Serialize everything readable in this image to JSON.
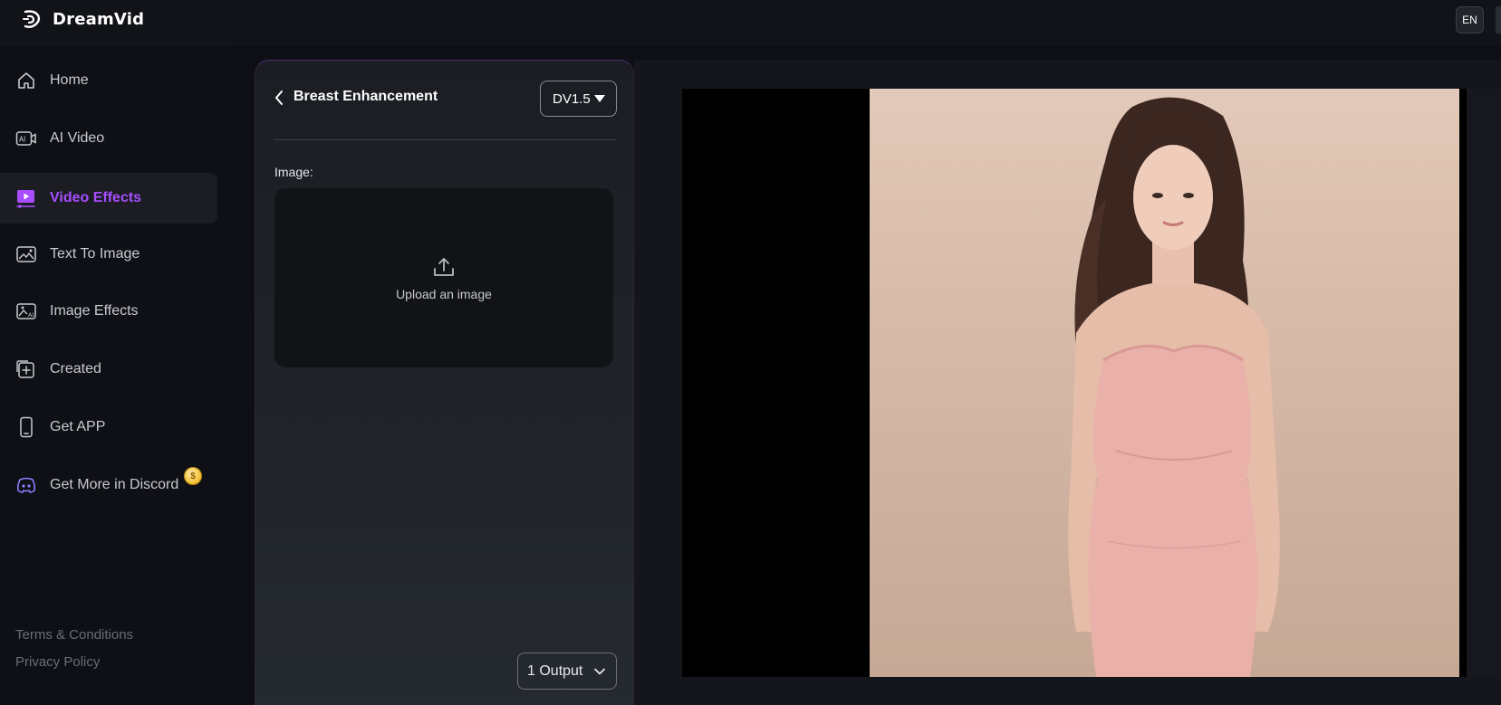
{
  "app": {
    "name": "DreamVid",
    "language": "EN"
  },
  "sidebar": {
    "items": [
      {
        "label": "Home",
        "icon": "home-icon",
        "active": false
      },
      {
        "label": "AI Video",
        "icon": "ai-video-icon",
        "active": false
      },
      {
        "label": "Video Effects",
        "icon": "video-effects-icon",
        "active": true
      },
      {
        "label": "Text To Image",
        "icon": "text-to-image-icon",
        "active": false
      },
      {
        "label": "Image Effects",
        "icon": "image-effects-icon",
        "active": false
      },
      {
        "label": "Created",
        "icon": "created-icon",
        "active": false
      },
      {
        "label": "Get APP",
        "icon": "phone-icon",
        "active": false
      },
      {
        "label": "Get More in Discord",
        "icon": "discord-icon",
        "active": false
      }
    ],
    "footer_links": [
      "Terms & Conditions",
      "Privacy Policy"
    ]
  },
  "panel": {
    "title": "Breast Enhancement",
    "model": "DV1.5",
    "image_label": "Image:",
    "upload_text": "Upload an image",
    "output_count": "1 Output"
  },
  "colors": {
    "accent": "#a84dff",
    "background": "#0e0f14",
    "panel_border": "#4a2d7a"
  }
}
